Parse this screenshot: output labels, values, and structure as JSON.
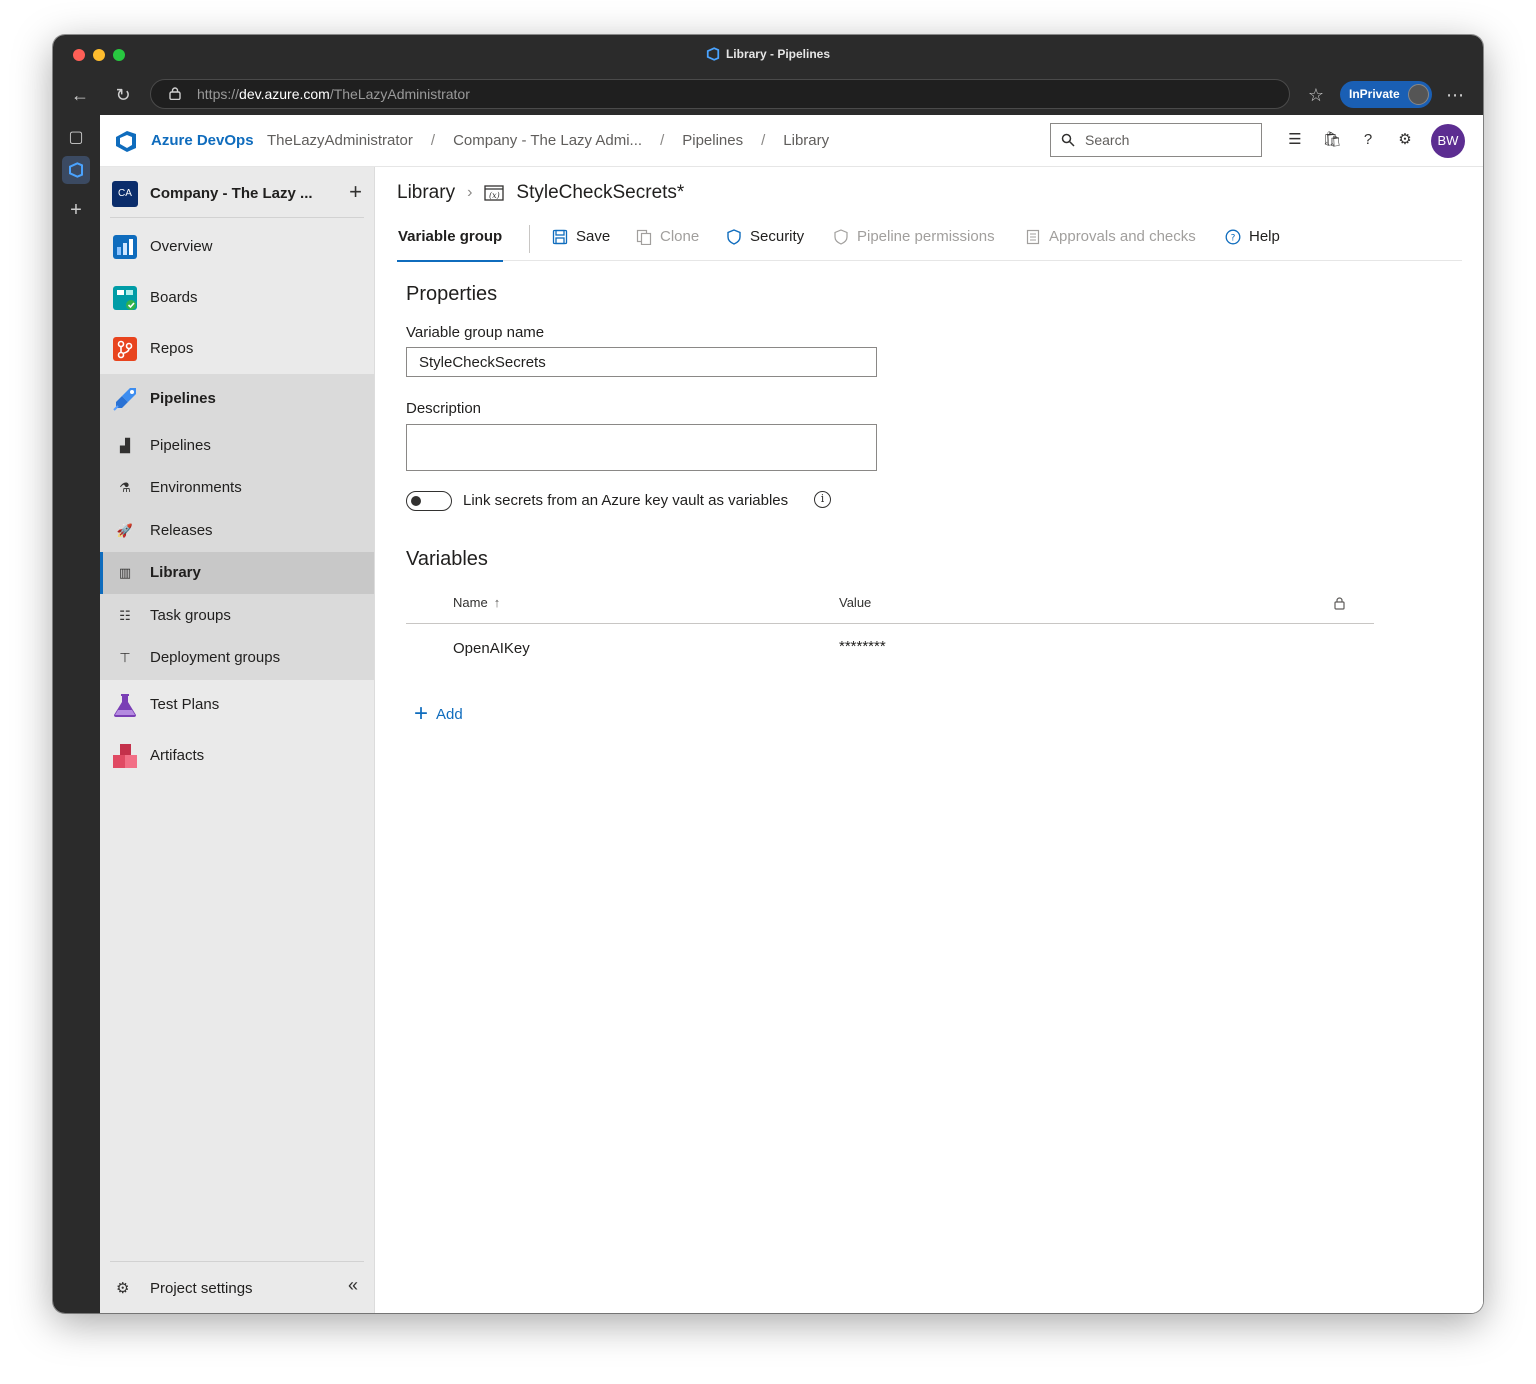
{
  "window": {
    "title": "Library - Pipelines",
    "url_scheme": "https://",
    "url_host": "dev.azure.com",
    "url_path": "/TheLazyAdministrator",
    "inprivate_label": "InPrivate"
  },
  "topbar": {
    "brand": "Azure DevOps",
    "breadcrumbs": [
      "TheLazyAdministrator",
      "Company - The Lazy Admi...",
      "Pipelines",
      "Library"
    ],
    "breadcrumb_separator": "/",
    "search_placeholder": "Search",
    "avatar_initials": "BW"
  },
  "sidebar": {
    "project_badge": "CA",
    "project_name": "Company - The Lazy ...",
    "add_label": "+",
    "items": [
      {
        "label": "Overview",
        "icon": "overview-icon",
        "color": "#0f6cbd"
      },
      {
        "label": "Boards",
        "icon": "boards-icon",
        "color": "#009ca6"
      },
      {
        "label": "Repos",
        "icon": "repos-icon",
        "color": "#e8441e"
      },
      {
        "label": "Pipelines",
        "icon": "pipelines-icon",
        "color": "#2a72d4"
      }
    ],
    "pipeline_children": [
      {
        "label": "Pipelines",
        "icon": "pipelines-sub-icon"
      },
      {
        "label": "Environments",
        "icon": "environments-icon"
      },
      {
        "label": "Releases",
        "icon": "releases-icon"
      },
      {
        "label": "Library",
        "icon": "library-icon",
        "selected": true
      },
      {
        "label": "Task groups",
        "icon": "task-groups-icon"
      },
      {
        "label": "Deployment groups",
        "icon": "deployment-groups-icon"
      }
    ],
    "items_after": [
      {
        "label": "Test Plans",
        "icon": "test-plans-icon",
        "color": "#7a3fb5"
      },
      {
        "label": "Artifacts",
        "icon": "artifacts-icon",
        "color": "#c4314b"
      }
    ],
    "project_settings": "Project settings",
    "collapse_glyph": "«"
  },
  "page": {
    "root_crumb": "Library",
    "title": "StyleCheckSecrets*",
    "tabs": {
      "active": "Variable group"
    },
    "toolbar": {
      "save": "Save",
      "clone": "Clone",
      "security": "Security",
      "pipeline_permissions": "Pipeline permissions",
      "approvals": "Approvals and checks",
      "help": "Help"
    },
    "properties": {
      "heading": "Properties",
      "name_label": "Variable group name",
      "name_value": "StyleCheckSecrets",
      "description_label": "Description",
      "description_value": "",
      "keyvault_toggle_label": "Link secrets from an Azure key vault as variables",
      "keyvault_toggle_on": false,
      "info_glyph": "i"
    },
    "variables": {
      "heading": "Variables",
      "columns": {
        "name": "Name",
        "value": "Value"
      },
      "sort_glyph": "↑",
      "rows": [
        {
          "name": "OpenAIKey",
          "value": "********"
        }
      ],
      "add_label": "Add",
      "add_glyph": "+"
    }
  },
  "colors": {
    "accent": "#0f6cbd",
    "avatar": "#5c2d91",
    "sidebar_bg": "#eaeaea",
    "browser_chrome": "#2b2b2b"
  }
}
